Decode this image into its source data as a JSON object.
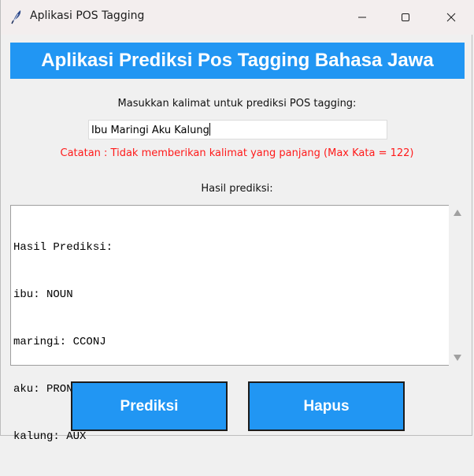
{
  "window": {
    "title": "Aplikasi POS Tagging",
    "app_icon": "feather-icon",
    "controls": [
      "minimize-icon",
      "maximize-icon",
      "close-icon"
    ]
  },
  "header": {
    "title": "Aplikasi Prediksi Pos Tagging Bahasa Jawa"
  },
  "input_section": {
    "prompt": "Masukkan kalimat untuk prediksi POS tagging:",
    "value": "Ibu Maringi Aku Kalung",
    "note": "Catatan : Tidak memberikan kalimat yang panjang (Max Kata = 122)"
  },
  "result_section": {
    "label": "Hasil prediksi:",
    "lines": [
      "Hasil Prediksi:",
      "ibu: NOUN",
      "maringi: CCONJ",
      "aku: PRON",
      "kalung: AUX"
    ]
  },
  "buttons": {
    "predict": "Prediksi",
    "clear": "Hapus"
  },
  "colors": {
    "accent": "#2196F3",
    "note": "#FF1A1A"
  }
}
